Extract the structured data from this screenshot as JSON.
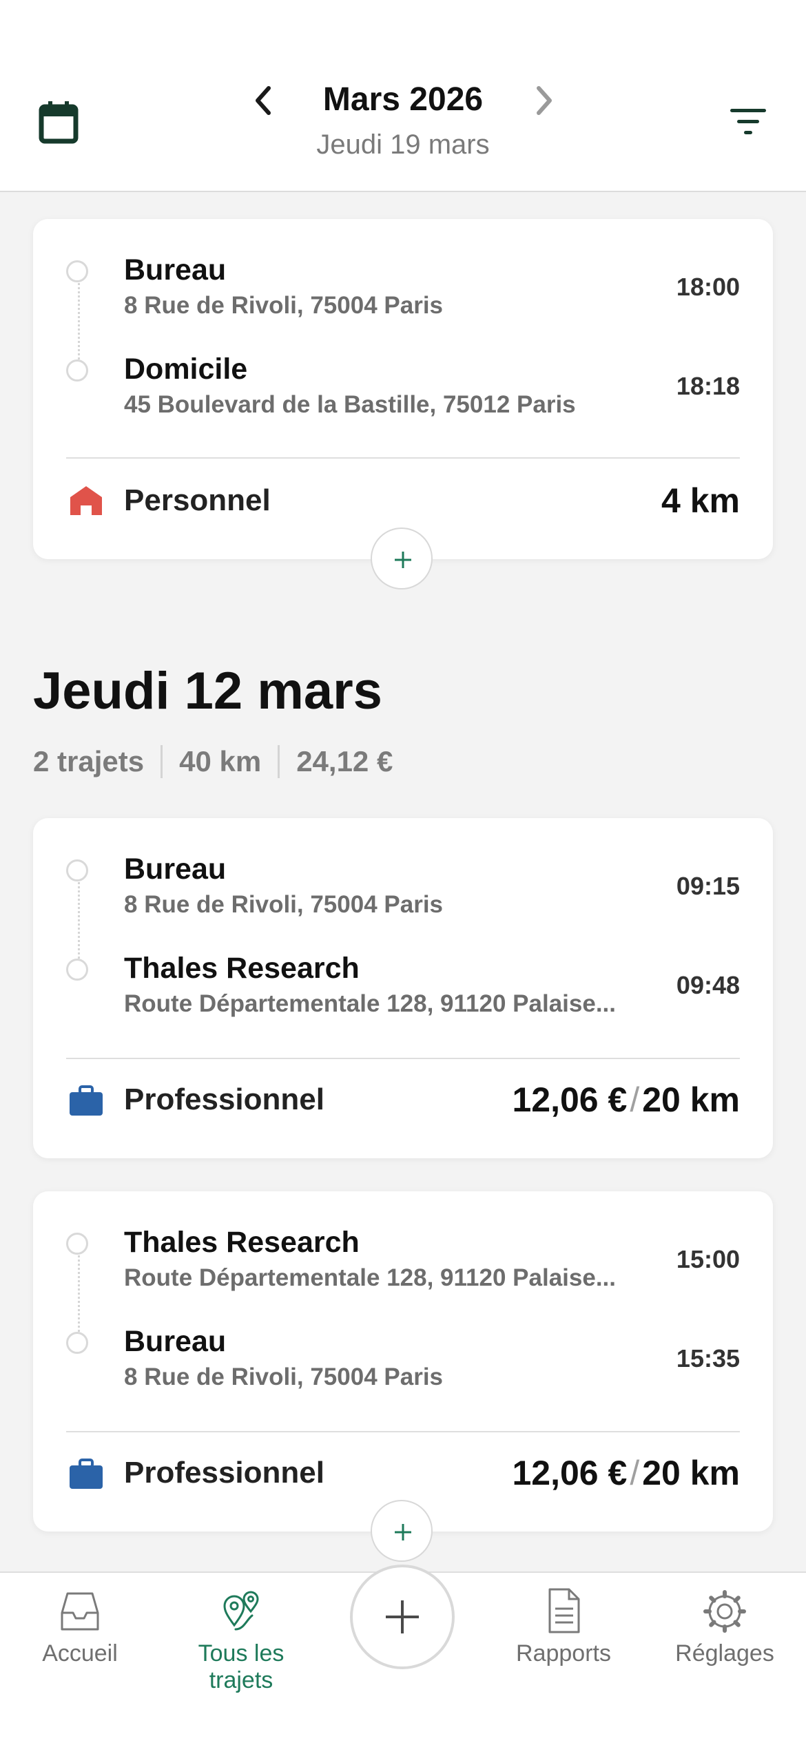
{
  "header": {
    "month": "Mars 2026",
    "subtitle": "Jeudi 19 mars",
    "icons": {
      "calendar": "calendar-icon",
      "prev": "chevron-left-icon",
      "next": "chevron-right-icon",
      "filter": "filter-icon"
    }
  },
  "card1": {
    "stops": [
      {
        "place": "Bureau",
        "address": "8 Rue de Rivoli, 75004 Paris",
        "time": "18:00"
      },
      {
        "place": "Domicile",
        "address": "45 Boulevard de la Bastille, 75012 Paris",
        "time": "18:18"
      }
    ],
    "category": "Personnel",
    "category_color": "#e0534a",
    "distance": "4 km"
  },
  "day": {
    "title": "Jeudi 12 mars",
    "trips": "2 trajets",
    "km": "40 km",
    "amount": "24,12 €"
  },
  "card2": {
    "stops": [
      {
        "place": "Bureau",
        "address": "8 Rue de Rivoli, 75004 Paris",
        "time": "09:15"
      },
      {
        "place": "Thales Research",
        "address": "Route Départementale 128, 91120 Palaise...",
        "time": "09:48"
      }
    ],
    "category": "Professionnel",
    "category_color": "#2b63a8",
    "amount": "12,06 €",
    "separator": "/",
    "distance": "20 km"
  },
  "card3": {
    "stops": [
      {
        "place": "Thales Research",
        "address": "Route Départementale 128, 91120 Palaise...",
        "time": "15:00"
      },
      {
        "place": "Bureau",
        "address": "8 Rue de Rivoli, 75004 Paris",
        "time": "15:35"
      }
    ],
    "category": "Professionnel",
    "category_color": "#2b63a8",
    "amount": "12,06 €",
    "separator": "/",
    "distance": "20 km"
  },
  "tabbar": {
    "items": [
      {
        "label": "Accueil",
        "icon": "inbox-icon"
      },
      {
        "label": "Tous les trajets",
        "icon": "map-pins-icon",
        "active": true
      },
      {
        "label": "Rapports",
        "icon": "document-icon"
      },
      {
        "label": "Réglages",
        "icon": "gear-icon"
      }
    ],
    "accent": "#1e7a5a"
  }
}
